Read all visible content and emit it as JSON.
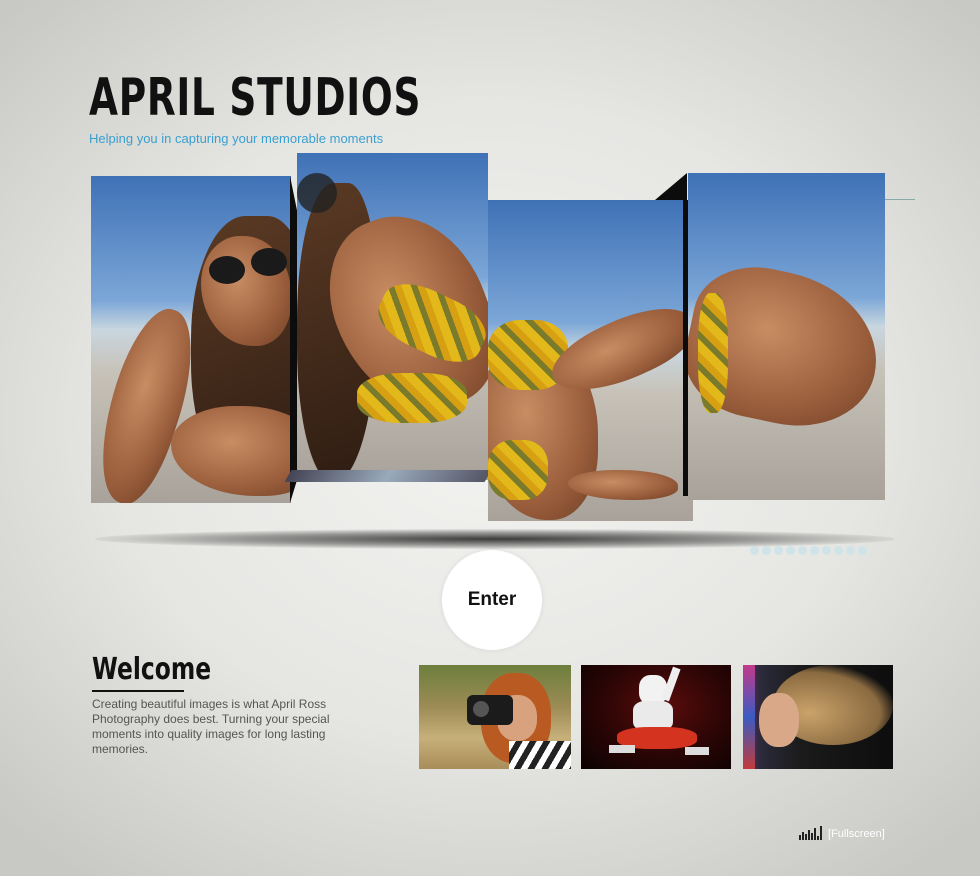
{
  "brand": {
    "title": "APRIL STUDIOS",
    "tagline": "Helping you in capturing your memorable moments"
  },
  "gallery": {
    "panels": [
      {
        "name": "photo-panel-1",
        "icon": "beach-portrait-image"
      },
      {
        "name": "photo-panel-2",
        "icon": "beach-portrait-image"
      },
      {
        "name": "photo-panel-3",
        "icon": "beach-portrait-image"
      },
      {
        "name": "photo-panel-4",
        "icon": "beach-portrait-image"
      }
    ],
    "pager_dots": 10,
    "active_dot": 0
  },
  "enter": {
    "label": "Enter"
  },
  "welcome": {
    "title": "Welcome",
    "text": "Creating beautiful images is what April Ross Photography does best. Turning your special moments into quality images for long lasting memories."
  },
  "thumbnails": [
    {
      "name": "thumb-photographer",
      "icon": "photographer-with-camera-image"
    },
    {
      "name": "thumb-dancer",
      "icon": "dancer-image"
    },
    {
      "name": "thumb-hair-portrait",
      "icon": "hair-portrait-image"
    }
  ],
  "footer": {
    "fullscreen_label": "[Fullscreen]",
    "icon": "equalizer-icon"
  },
  "colors": {
    "accent": "#3aa0d0",
    "text": "#111111",
    "body_text": "#555555",
    "dot": "#cfe3e8"
  }
}
